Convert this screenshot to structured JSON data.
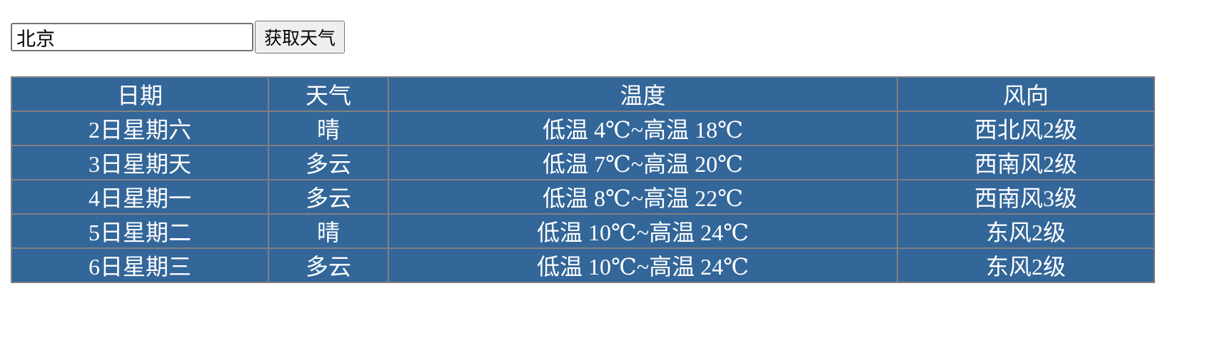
{
  "search": {
    "city_value": "北京",
    "button_label": "获取天气"
  },
  "table": {
    "headers": [
      "日期",
      "天气",
      "温度",
      "风向"
    ],
    "rows": [
      {
        "date": "2日星期六",
        "weather": "晴",
        "temp": "低温 4℃~高温 18℃",
        "wind": "西北风2级"
      },
      {
        "date": "3日星期天",
        "weather": "多云",
        "temp": "低温 7℃~高温 20℃",
        "wind": "西南风2级"
      },
      {
        "date": "4日星期一",
        "weather": "多云",
        "temp": "低温 8℃~高温 22℃",
        "wind": "西南风3级"
      },
      {
        "date": "5日星期二",
        "weather": "晴",
        "temp": "低温 10℃~高温 24℃",
        "wind": "东风2级"
      },
      {
        "date": "6日星期三",
        "weather": "多云",
        "temp": "低温 10℃~高温 24℃",
        "wind": "东风2级"
      }
    ]
  },
  "colors": {
    "table_background": "#336699",
    "table_border": "#808080",
    "table_text": "#ffffff"
  }
}
